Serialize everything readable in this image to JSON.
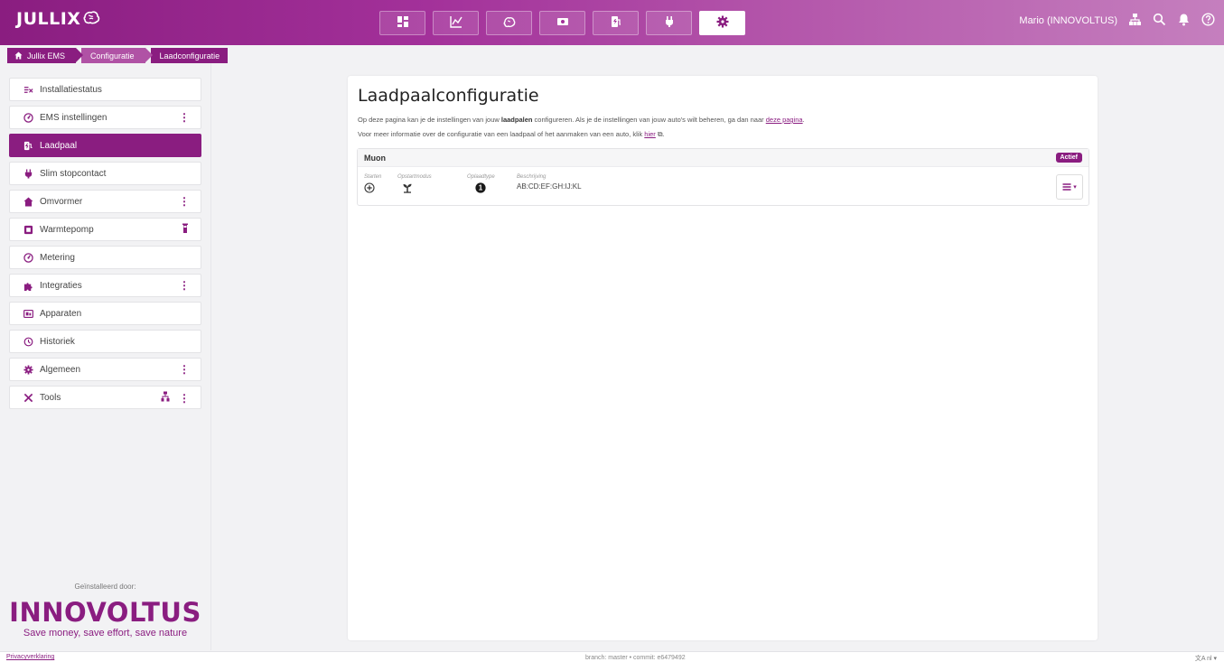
{
  "header": {
    "logo": "JULLIX",
    "user": "Mario (INNOVOLTUS)",
    "nav": [
      "dashboard-icon",
      "chart-icon",
      "brain-icon",
      "money-icon",
      "charger-icon",
      "plug-icon",
      "gear-icon"
    ],
    "active_nav": "gear-icon",
    "brand_color": "#8a1d80"
  },
  "breadcrumb": [
    "Jullix EMS",
    "Configuratie",
    "Laadconfiguratie"
  ],
  "sidebar": {
    "items": [
      {
        "label": "Installatiestatus",
        "icon": "status-icon"
      },
      {
        "label": "EMS instellingen",
        "icon": "meter-icon"
      },
      {
        "label": "Laadpaal",
        "icon": "charger-icon"
      },
      {
        "label": "Slim stopcontact",
        "icon": "plug-icon"
      },
      {
        "label": "Omvormer",
        "icon": "home-icon"
      },
      {
        "label": "Warmtepomp",
        "icon": "heatpump-icon"
      },
      {
        "label": "Metering",
        "icon": "meter-icon"
      },
      {
        "label": "Integraties",
        "icon": "puzzle-icon"
      },
      {
        "label": "Apparaten",
        "icon": "devices-icon"
      },
      {
        "label": "Historiek",
        "icon": "history-icon"
      },
      {
        "label": "Algemeen",
        "icon": "gear-icon"
      },
      {
        "label": "Tools",
        "icon": "tools-icon"
      }
    ],
    "installer_label": "Geïnstalleerd door:",
    "installer_brand": "INNOVOLTUS",
    "installer_slogan": "Save money, save effort, save nature"
  },
  "main": {
    "title": "Laadpaalconfiguratie",
    "desc1_pre": "Op deze pagina kan je de instellingen van jouw ",
    "desc1_bold": "laadpalen",
    "desc1_mid": " configureren. Als je de instellingen van jouw auto's wilt beheren, ga dan naar ",
    "desc1_link": "deze pagina",
    "desc1_end": ".",
    "desc2_pre": "Voor meer informatie over de configuratie van een laadpaal of het aanmaken van een auto, klik ",
    "desc2_link": "hier",
    "desc2_end": ".",
    "charger": {
      "name": "Muon",
      "status": "Actief",
      "col_start": "Starten",
      "col_mode": "Opstartmodus",
      "col_type": "Oplaadtype",
      "col_desc": "Beschrijving",
      "type_value": "1",
      "description": "AB:CD:EF:GH:IJ:KL"
    }
  },
  "footer": {
    "privacy": "Privacyverklaring",
    "commit": "branch: master • commit: e6479492",
    "lang": "nl"
  }
}
